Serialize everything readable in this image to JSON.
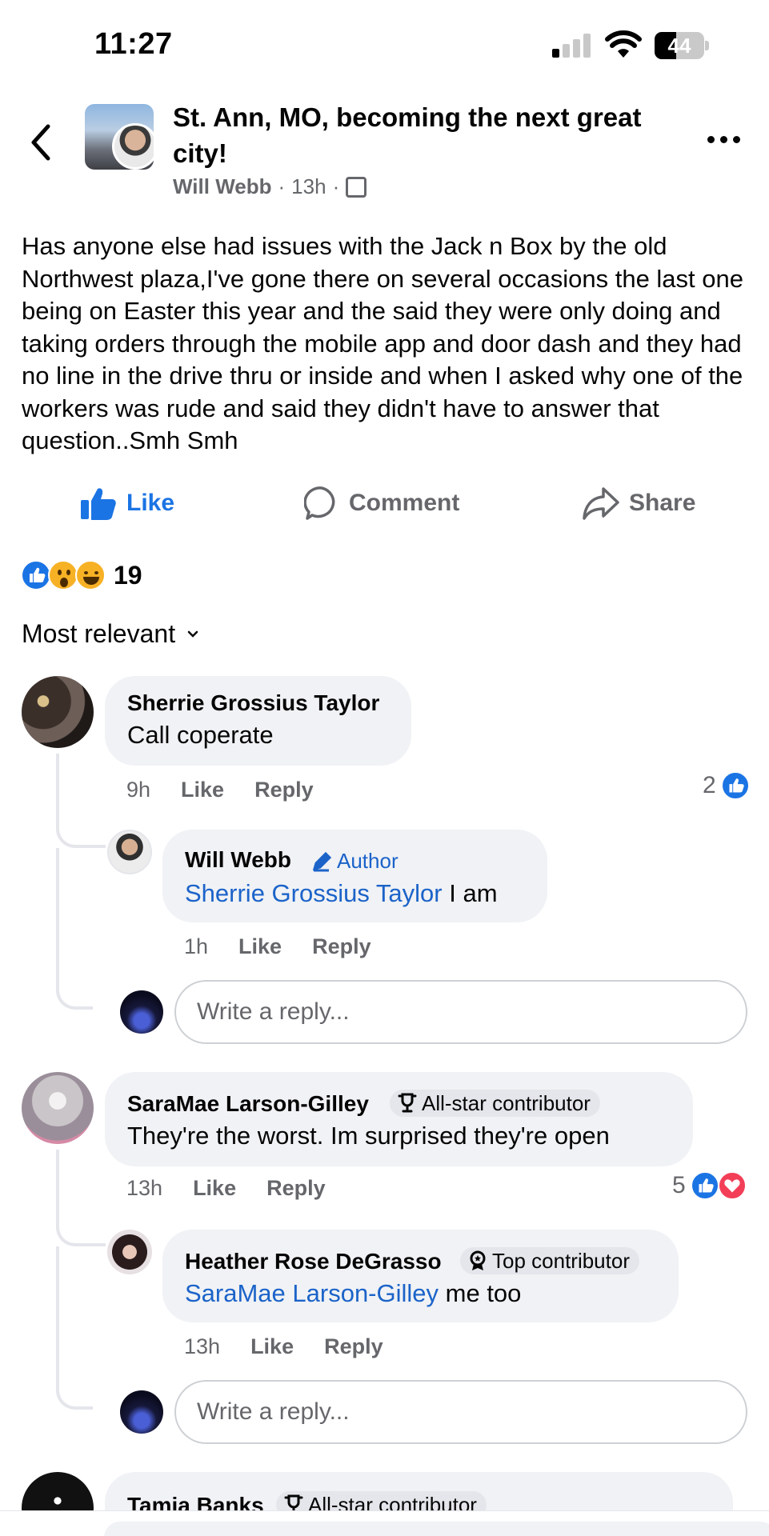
{
  "status_bar": {
    "time": "11:27",
    "battery": "44",
    "battery_level": 0.44
  },
  "header": {
    "title": "St. Ann, MO, becoming the next great city!",
    "author": "Will Webb",
    "time": "13h",
    "separator": "·"
  },
  "post": {
    "text": "Has anyone else had issues with the Jack n Box by the old Northwest plaza,I've gone there  on several occasions the last one being on Easter this year and the said they were only doing and taking orders through the mobile app and door dash and they had no line in the drive thru or inside and when I asked why one of the workers was rude and said they didn't have to answer that question..Smh Smh"
  },
  "actions": {
    "like": "Like",
    "comment": "Comment",
    "share": "Share"
  },
  "reactions": {
    "count": "19",
    "types": [
      "like",
      "wow",
      "haha"
    ]
  },
  "sort": {
    "label": "Most relevant"
  },
  "comments": [
    {
      "name": "Sherrie Grossius Taylor",
      "text": "Call coperate",
      "time": "9h",
      "like": "Like",
      "reply": "Reply",
      "likes": "2",
      "replies": [
        {
          "name": "Will Webb",
          "tag": "Author",
          "mention": "Sherrie Grossius Taylor",
          "text": " I am",
          "time": "1h",
          "like": "Like",
          "reply": "Reply"
        }
      ],
      "reply_placeholder": "Write a reply..."
    },
    {
      "name": "SaraMae Larson-Gilley",
      "badge": "All-star contributor",
      "text": "They're the worst. Im surprised they're open",
      "time": "13h",
      "like": "Like",
      "reply": "Reply",
      "likes": "5",
      "replies": [
        {
          "name": "Heather Rose DeGrasso",
          "badge": "Top contributor",
          "mention": "SaraMae Larson-Gilley",
          "text": " me too",
          "time": "13h",
          "like": "Like",
          "reply": "Reply"
        }
      ],
      "reply_placeholder": "Write a reply..."
    },
    {
      "name": "Tamia Banks",
      "badge": "All-star contributor"
    }
  ]
}
